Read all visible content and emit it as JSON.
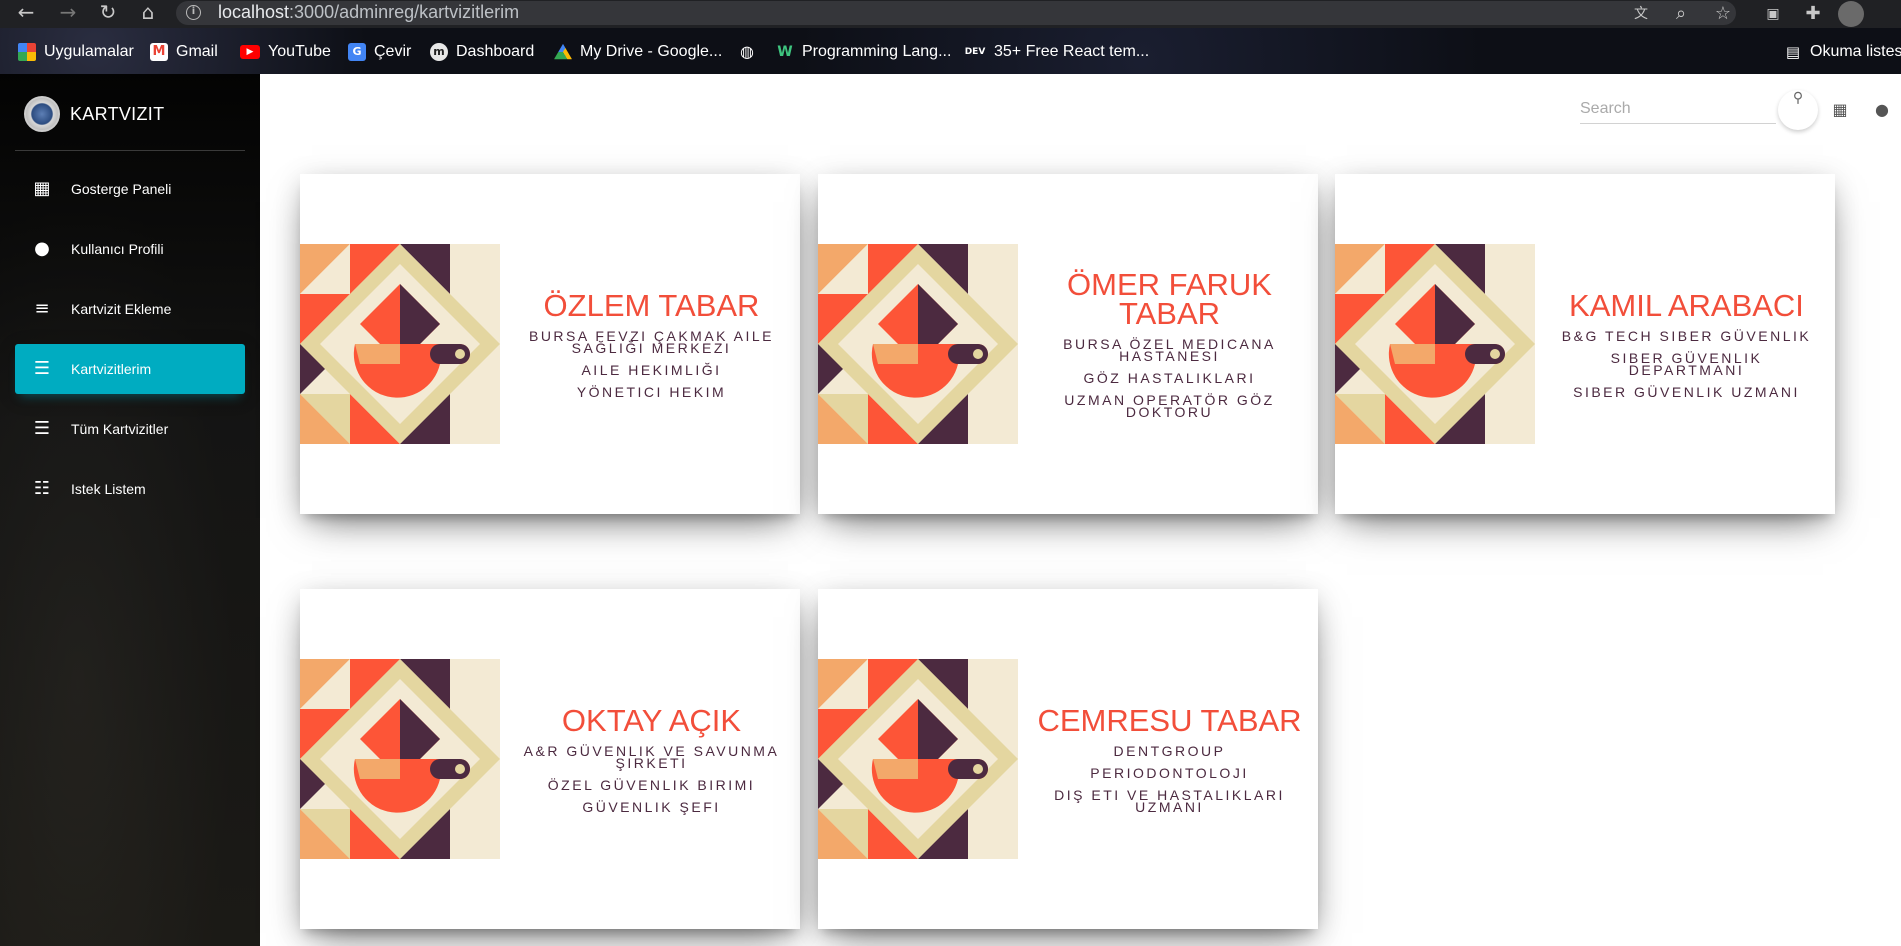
{
  "browser": {
    "url_host": "localhost",
    "url_path": ":3000/adminreg/kartvizitlerim",
    "bookmarks": [
      {
        "label": "Uygulamalar",
        "icon": "apps-grid-icon"
      },
      {
        "label": "Gmail",
        "icon": "gmail-icon"
      },
      {
        "label": "YouTube",
        "icon": "youtube-icon"
      },
      {
        "label": "Çevir",
        "icon": "translate-icon"
      },
      {
        "label": "Dashboard",
        "icon": "dashboard-site-icon"
      },
      {
        "label": "My Drive - Google...",
        "icon": "google-drive-icon"
      },
      {
        "label": "",
        "icon": "globe-icon"
      },
      {
        "label": "Programming Lang...",
        "icon": "w-site-icon"
      },
      {
        "label": "35+ Free React tem...",
        "icon": "dev-icon"
      }
    ],
    "reading_list": "Okuma listesi"
  },
  "sidebar": {
    "brand": "KARTVIZIT",
    "items": [
      {
        "label": "Gosterge Paneli",
        "icon": "dashboard-icon",
        "active": false
      },
      {
        "label": "Kullanıcı Profili",
        "icon": "person-icon",
        "active": false
      },
      {
        "label": "Kartvizit Ekleme",
        "icon": "playlist-add-icon",
        "active": false
      },
      {
        "label": "Kartvizitlerim",
        "icon": "storage-icon",
        "active": true
      },
      {
        "label": "Tüm Kartvizitler",
        "icon": "storage-icon",
        "active": false
      },
      {
        "label": "Istek Listem",
        "icon": "list-icon",
        "active": false
      }
    ]
  },
  "header": {
    "search_placeholder": "Search"
  },
  "cards": [
    {
      "name": "ÖZLEM TABAR",
      "lines": [
        "BURSA FEVZI ÇAKMAK AILE SAĞLIĞI MERKEZI",
        "AILE HEKIMLIĞI",
        "YÖNETICI HEKIM"
      ]
    },
    {
      "name": "ÖMER FARUK TABAR",
      "lines": [
        "BURSA ÖZEL MEDICANA HASTANESI",
        "GÖZ HASTALIKLARI",
        "UZMAN OPERATÖR GÖZ DOKTORU"
      ]
    },
    {
      "name": "KAMIL ARABACI",
      "lines": [
        "B&G TECH SIBER GÜVENLIK",
        "SIBER GÜVENLIK DEPARTMANI",
        "SIBER GÜVENLIK UZMANI"
      ]
    },
    {
      "name": "OKTAY AÇIK",
      "lines": [
        "A&R GÜVENLIK VE SAVUNMA ŞIRKETI",
        "ÖZEL GÜVENLIK BIRIMI",
        "GÜVENLIK ŞEFI"
      ]
    },
    {
      "name": "CEMRESU TABAR",
      "lines": [
        "DENTGROUP",
        "PERIODONTOLOJI",
        "DIŞ ETI VE HASTALIKLARI UZMANI"
      ]
    }
  ],
  "colors": {
    "accent": "#00acc1",
    "name_red": "#f24e3a",
    "plum": "#4c2a40",
    "cream": "#f3ead4",
    "tan": "#e4d6a0",
    "peach": "#f3a86a",
    "orange_red": "#fd5537"
  }
}
